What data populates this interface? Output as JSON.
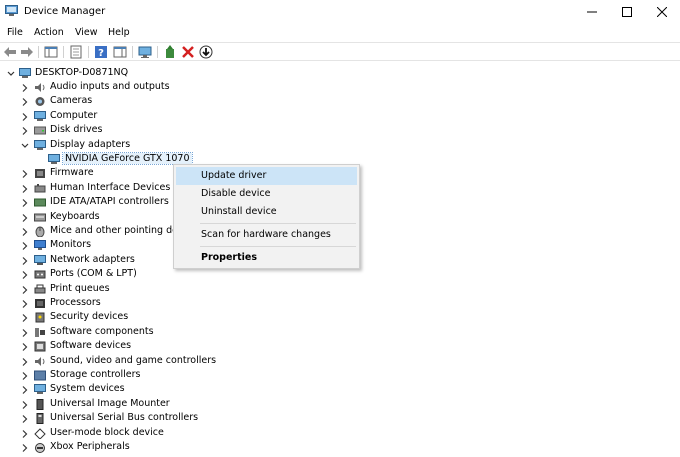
{
  "window": {
    "title": "Device Manager",
    "minimize_icon": "minimize-icon",
    "maximize_icon": "maximize-icon",
    "close_icon": "close-icon"
  },
  "menubar": {
    "items": [
      "File",
      "Action",
      "View",
      "Help"
    ]
  },
  "toolbar": {
    "icons": [
      "back-arrow-icon",
      "forward-arrow-icon",
      "console-tree-icon",
      "properties-sheet-icon",
      "help-icon",
      "action-pane-icon",
      "monitor-scan-icon",
      "add-driver-icon",
      "uninstall-x-icon",
      "download-icon"
    ]
  },
  "tree": {
    "root": "DESKTOP-D0871NQ",
    "categories": [
      {
        "label": "Audio inputs and outputs",
        "icon": "speaker-icon"
      },
      {
        "label": "Cameras",
        "icon": "camera-icon"
      },
      {
        "label": "Computer",
        "icon": "computer-icon"
      },
      {
        "label": "Disk drives",
        "icon": "disk-icon"
      },
      {
        "label": "Display adapters",
        "icon": "display-adapter-icon",
        "expanded": true
      },
      {
        "label": "Firmware",
        "icon": "firmware-icon"
      },
      {
        "label": "Human Interface Devices",
        "icon": "hid-icon"
      },
      {
        "label": "IDE ATA/ATAPI controllers",
        "icon": "ide-icon"
      },
      {
        "label": "Keyboards",
        "icon": "keyboard-icon"
      },
      {
        "label": "Mice and other pointing devic",
        "icon": "mouse-icon"
      },
      {
        "label": "Monitors",
        "icon": "monitor-icon"
      },
      {
        "label": "Network adapters",
        "icon": "network-icon"
      },
      {
        "label": "Ports (COM & LPT)",
        "icon": "port-icon"
      },
      {
        "label": "Print queues",
        "icon": "printer-icon"
      },
      {
        "label": "Processors",
        "icon": "processor-icon"
      },
      {
        "label": "Security devices",
        "icon": "security-icon"
      },
      {
        "label": "Software components",
        "icon": "software-component-icon"
      },
      {
        "label": "Software devices",
        "icon": "software-device-icon"
      },
      {
        "label": "Sound, video and game controllers",
        "icon": "sound-icon"
      },
      {
        "label": "Storage controllers",
        "icon": "storage-icon"
      },
      {
        "label": "System devices",
        "icon": "system-icon"
      },
      {
        "label": "Universal Image Mounter",
        "icon": "image-mounter-icon"
      },
      {
        "label": "Universal Serial Bus controllers",
        "icon": "usb-icon"
      },
      {
        "label": "User-mode block device",
        "icon": "block-device-icon"
      },
      {
        "label": "Xbox Peripherals",
        "icon": "xbox-icon"
      }
    ],
    "child_device": "NVIDIA GeForce GTX 1070"
  },
  "context_menu": {
    "items": [
      "Update driver",
      "Disable device",
      "Uninstall device",
      "Scan for hardware changes",
      "Properties"
    ],
    "highlighted": "Update driver"
  },
  "colors": {
    "selection": "#e5f1fb",
    "menu_highlight": "#cce4f7",
    "menu_bg": "#f2f2f2"
  }
}
